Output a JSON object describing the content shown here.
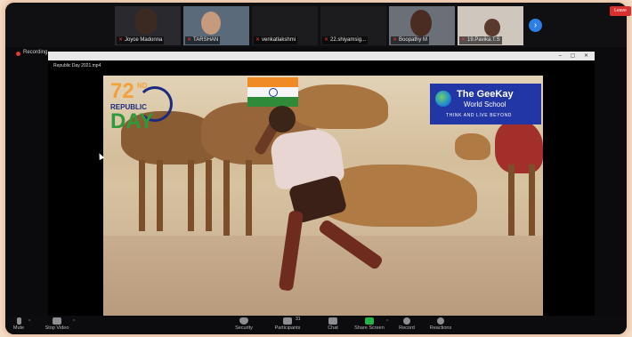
{
  "participants": [
    {
      "name": "Joyce Madonna",
      "muted": true
    },
    {
      "name": "TARSHAN",
      "muted": true
    },
    {
      "name": "venkatlakshmi",
      "muted": true
    },
    {
      "name": "22.shiyamsig...",
      "muted": true
    },
    {
      "name": "Boopathy M",
      "muted": true
    },
    {
      "name": "19.Pavika.T.S",
      "muted": true
    }
  ],
  "recording_label": "Recording...",
  "media_title": "Republic Day 2021.mp4",
  "video": {
    "republic_day_number": "72",
    "republic_day_suffix": "ND",
    "republic_word": "REPUBLIC",
    "day_word": "DAY",
    "school_name_line1": "The GeeKay",
    "school_name_line2": "World School",
    "school_tagline": "THINK AND LIVE BEYOND"
  },
  "toolbar": {
    "mute": "Mute",
    "stop_video": "Stop Video",
    "security": "Security",
    "participants": "Participants",
    "participants_count": "31",
    "chat": "Chat",
    "share_screen": "Share Screen",
    "record": "Record",
    "reactions": "Reactions",
    "leave": "Leave"
  },
  "colors": {
    "share_green": "#27b14a",
    "leave_red": "#d9302f",
    "next_blue": "#2d7fe6",
    "school_blue": "#2236a5"
  }
}
